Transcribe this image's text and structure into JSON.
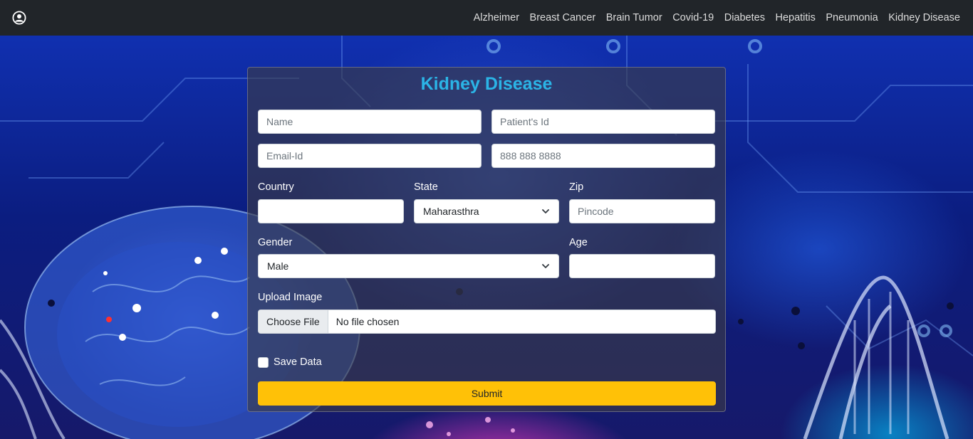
{
  "navbar": {
    "user_icon": "user-circle-icon",
    "links": [
      "Alzheimer",
      "Breast Cancer",
      "Brain Tumor",
      "Covid-19",
      "Diabetes",
      "Hepatitis",
      "Pneumonia",
      "Kidney Disease"
    ]
  },
  "form": {
    "title": "Kidney Disease",
    "name_placeholder": "Name",
    "patient_id_placeholder": "Patient's Id",
    "email_placeholder": "Email-Id",
    "phone_placeholder": "888 888 8888",
    "country_label": "Country",
    "country_value": "",
    "state_label": "State",
    "state_value": "Maharasthra",
    "zip_label": "Zip",
    "zip_placeholder": "Pincode",
    "gender_label": "Gender",
    "gender_value": "Male",
    "age_label": "Age",
    "age_value": "",
    "upload_label": "Upload Image",
    "choose_file": "Choose File",
    "file_status": "No file chosen",
    "save_data_label": "Save Data",
    "save_data_checked": false,
    "submit_label": "Submit"
  },
  "colors": {
    "navbar_bg": "#212529",
    "title": "#2bb4e6",
    "submit_bg": "#ffc107"
  }
}
